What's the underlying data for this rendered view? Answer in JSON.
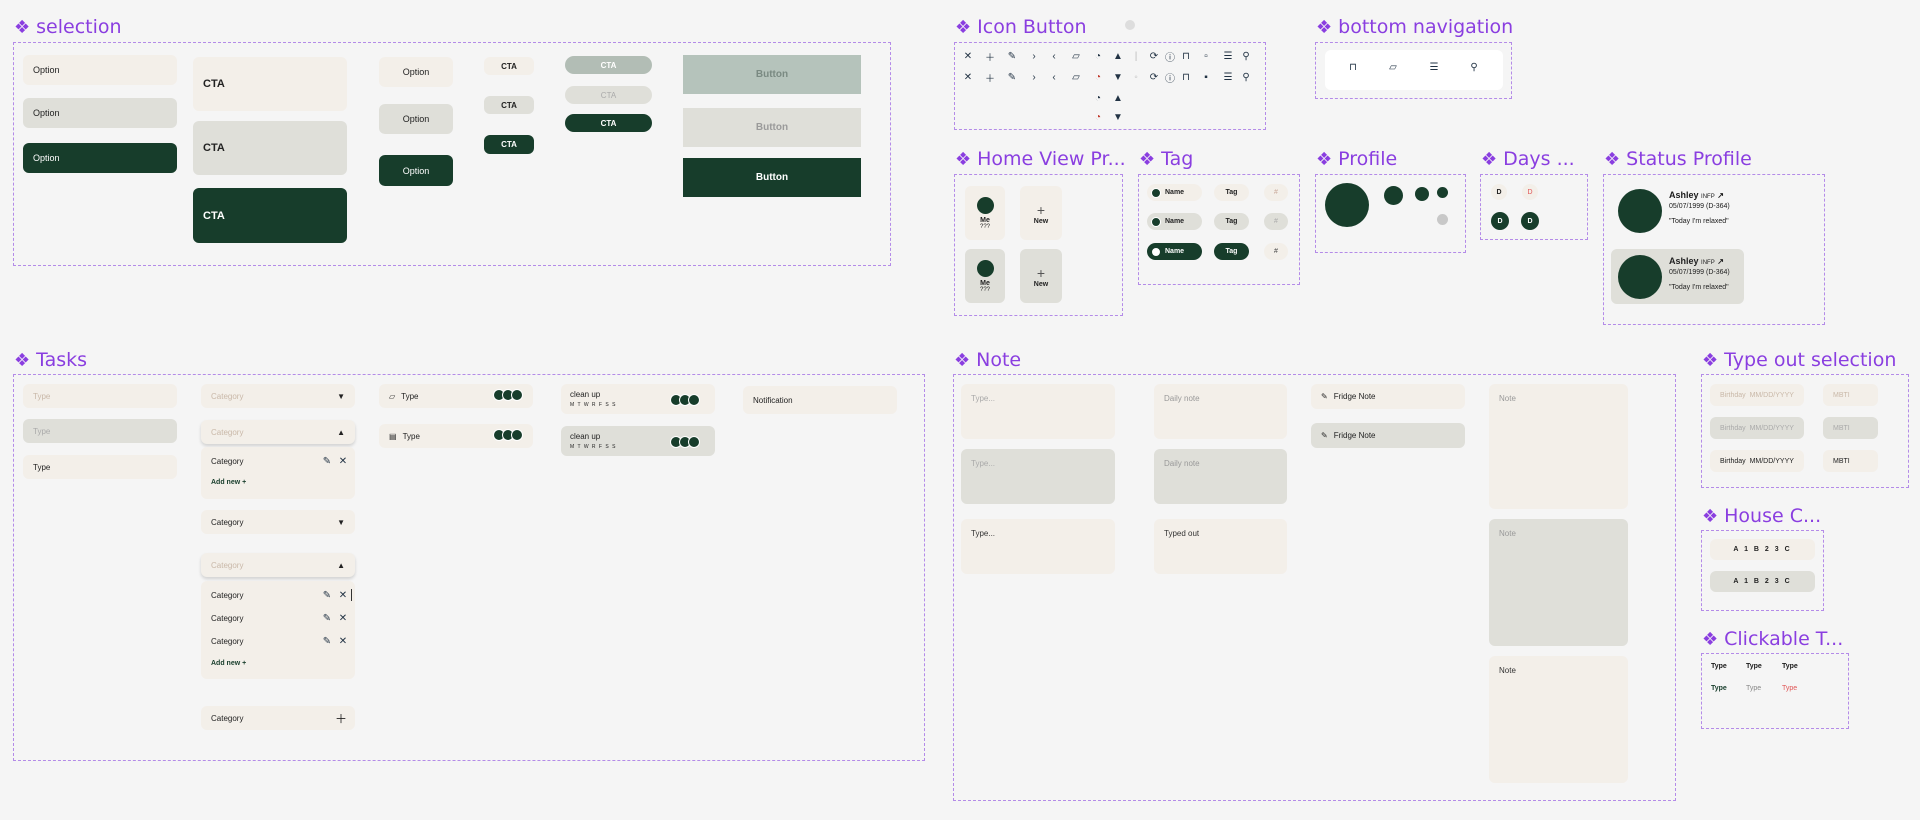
{
  "sections": {
    "selection": "selection",
    "icon_button": "Icon Button",
    "bottom_nav": "bottom navigation",
    "home_view": "Home View Pr...",
    "tag": "Tag",
    "profile": "Profile",
    "days": "Days ...",
    "status_profile": "Status Profile",
    "tasks": "Tasks",
    "note": "Note",
    "type_out": "Type out selection",
    "house": "House C...",
    "clickable": "Clickable T..."
  },
  "selection": {
    "option": "Option",
    "cta": "CTA",
    "button": "Button"
  },
  "home_view": {
    "me": "Me",
    "me_sub": "???",
    "new": "New",
    "plus": "+"
  },
  "tag": {
    "name": "Name",
    "tag": "Tag",
    "hash": "#"
  },
  "days": {
    "d": "D"
  },
  "status_profile": {
    "name": "Ashley",
    "mbti": "INFP",
    "date": "05/07/1999",
    "dday": "(D-364)",
    "quote": "\"Today I'm relaxed\""
  },
  "tasks": {
    "type": "Type",
    "category": "Category",
    "add_new": "Add new +",
    "clean_up": "clean up",
    "days_letters": "M T W R F S S",
    "notification": "Notification"
  },
  "note": {
    "type_placeholder": "Type...",
    "daily_note": "Daily note",
    "typed_out": "Typed out",
    "fridge_note": "Fridge Note",
    "note": "Note"
  },
  "type_out": {
    "birthday": "Birthday",
    "date_ph": "MM/DD/YYYY",
    "mbti": "MBTI"
  },
  "house": {
    "code": "A 1 B 2 3 C"
  },
  "clickable": {
    "type": "Type"
  },
  "colors": {
    "accent": "#8a3ee0",
    "dark_green": "#173d2b",
    "beige": "#f3efe9",
    "grey": "#dfdfd9"
  }
}
